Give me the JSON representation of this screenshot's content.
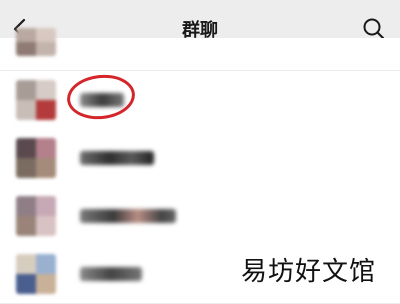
{
  "header": {
    "title": "群聊",
    "back_icon": "chevron-left-icon",
    "search_icon": "search-icon"
  },
  "watermark": "易坊好文馆",
  "colors": {
    "nav_background": "#ededed",
    "highlight_ring": "#d4252b"
  }
}
